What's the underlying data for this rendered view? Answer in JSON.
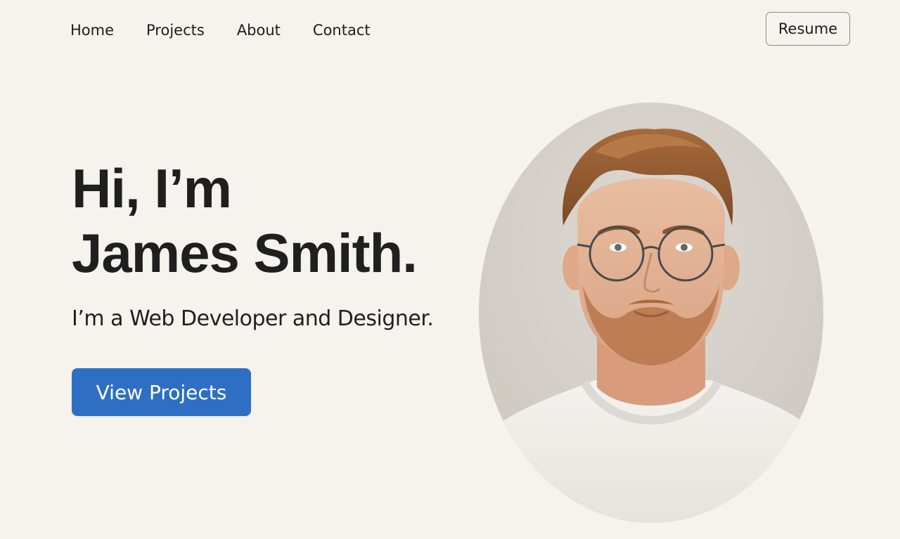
{
  "nav": {
    "items": [
      "Home",
      "Projects",
      "About",
      "Contact"
    ],
    "resume_label": "Resume"
  },
  "hero": {
    "greeting": "Hi, I’m",
    "name": "James Smith.",
    "tagline": "I’m a Web Developer and Designer.",
    "cta_label": "View Projects"
  },
  "colors": {
    "background": "#f6f3ee",
    "accent": "#2e6fc4",
    "text": "#1f1f1f",
    "portrait_background": "#d7d3cc"
  }
}
